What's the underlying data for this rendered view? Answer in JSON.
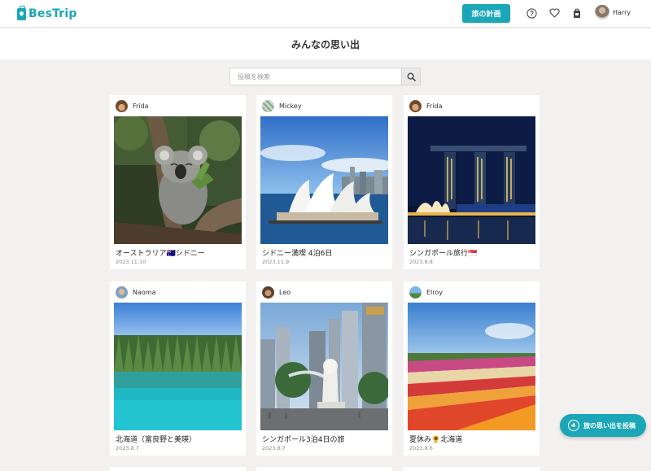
{
  "header": {
    "logo_text": "BesTrip",
    "plan_button": "旅の計画",
    "user_name": "Harry",
    "icons": [
      "help-icon",
      "heart-icon",
      "luggage-icon"
    ]
  },
  "page": {
    "title": "みんなの思い出"
  },
  "search": {
    "placeholder": "投稿を検索",
    "value": ""
  },
  "posts": [
    {
      "author": "Frida",
      "title": "オーストラリア🇦🇺シドニー",
      "date": "2023.11.10",
      "image": "koala"
    },
    {
      "author": "Mickey",
      "title": "シドニー満喫 4泊6日",
      "date": "2023.11.9",
      "image": "sydney-opera-house"
    },
    {
      "author": "Frida",
      "title": "シンガポール旅行🇸🇬",
      "date": "2023.8.8",
      "image": "marina-bay-sands"
    },
    {
      "author": "Naoma",
      "title": "北海道（富良野と美瑛）",
      "date": "2023.8.7",
      "image": "blue-pond"
    },
    {
      "author": "Leo",
      "title": "シンガポール3泊4日の旅",
      "date": "2023.8.7",
      "image": "merlion"
    },
    {
      "author": "Elroy",
      "title": "夏休み🌻北海道",
      "date": "2023.8.6",
      "image": "flower-field"
    }
  ],
  "fab": {
    "label": "旅の思い出を投稿"
  },
  "colors": {
    "accent": "#1ba7b7",
    "background": "#f2f1f0"
  }
}
